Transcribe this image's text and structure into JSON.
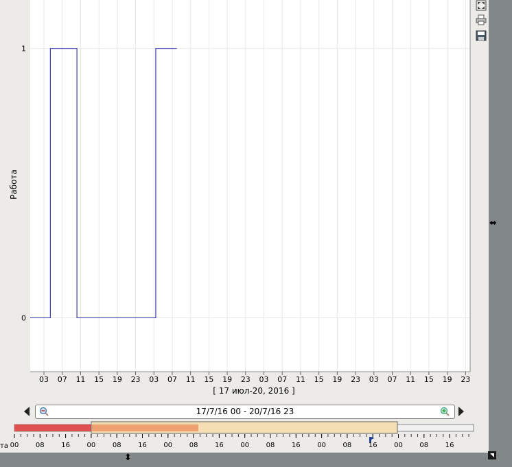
{
  "chart_data": {
    "type": "line",
    "step": true,
    "ylabel": "Работа",
    "xcaption": "[ 17 июл-20, 2016 ]",
    "y_ticks": [
      "0",
      "1"
    ],
    "ylim": [
      -0.2,
      1.18
    ],
    "x_ticks": [
      "03",
      "07",
      "11",
      "15",
      "19",
      "23",
      "03",
      "07",
      "11",
      "15",
      "19",
      "23",
      "03",
      "07",
      "11",
      "15",
      "19",
      "23",
      "03",
      "07",
      "11",
      "15",
      "19",
      "23"
    ],
    "x_tick_hours": [
      3,
      7,
      11,
      15,
      19,
      23,
      27,
      31,
      35,
      39,
      43,
      47,
      51,
      55,
      59,
      63,
      67,
      71,
      75,
      79,
      83,
      87,
      91,
      95
    ],
    "xlim_hours": [
      0,
      96
    ],
    "grid": true,
    "color": "#3b3bab",
    "series": [
      {
        "x_hours": [
          0,
          4.4,
          4.4,
          10.2,
          10.2,
          27.4,
          27.4,
          32.0
        ],
        "values": [
          0,
          0,
          1,
          1,
          0,
          0,
          1,
          1
        ]
      }
    ]
  },
  "navigator": {
    "range_label": "17/7/16 00 - 20/7/16 23",
    "side_label": "та",
    "tick_labels": [
      "00",
      "08",
      "16",
      "00",
      "08",
      "16",
      "00",
      "08",
      "16",
      "00",
      "08",
      "16",
      "00",
      "08",
      "16",
      "00",
      "08",
      "16"
    ]
  },
  "toolbar": {
    "fullscreen_icon": "fullscreen-icon",
    "print_icon": "print-icon",
    "save_icon": "save-icon"
  },
  "colors": {
    "line": "#3b3bab",
    "red": "#e05050",
    "orange": "#f0a070",
    "peach": "#f5deb3"
  }
}
